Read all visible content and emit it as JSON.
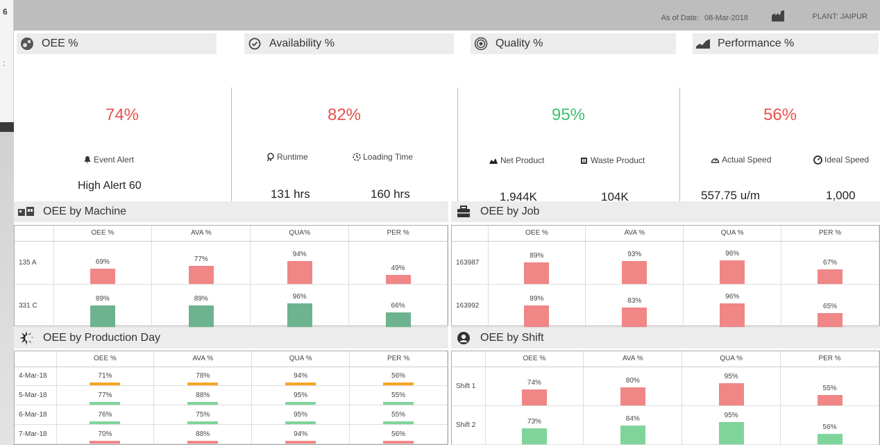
{
  "header": {
    "as_of_label": "As of Date:",
    "as_of_value": "08-Mar-2018",
    "plant": "PLANT: JAIPUR",
    "background_number": "6"
  },
  "kpis": {
    "oee": {
      "title": "OEE %",
      "value": "74%",
      "color": "#e8514a",
      "event_label": "Event Alert",
      "event_value": "High Alert 60"
    },
    "availability": {
      "title": "Availability %",
      "value": "82%",
      "color": "#e8514a",
      "runtime_label": "Runtime",
      "runtime_value": "131 hrs",
      "loading_label": "Loading Time",
      "loading_value": "160 hrs"
    },
    "quality": {
      "title": "Quality %",
      "value": "95%",
      "color": "#3fbf6e",
      "net_label": "Net Product",
      "net_value": "1,944K",
      "waste_label": "Waste Product",
      "waste_value": "104K"
    },
    "performance": {
      "title": "Performance %",
      "value": "56%",
      "color": "#e8514a",
      "actual_label": "Actual Speed",
      "actual_value": "557.75 u/m",
      "ideal_label": "Ideal Speed",
      "ideal_value": "1,000"
    }
  },
  "colors": {
    "red": "#f08686",
    "green": "#6db38f",
    "orange": "#f5a623",
    "light_green": "#7fd49a"
  },
  "machine": {
    "title": "OEE by Machine",
    "columns": [
      "OEE %",
      "AVA %",
      "QUA%",
      "PER %"
    ],
    "rows": [
      {
        "label": "135 A",
        "cells": [
          {
            "v": "69%",
            "n": 69,
            "c": "red"
          },
          {
            "v": "77%",
            "n": 77,
            "c": "red"
          },
          {
            "v": "94%",
            "n": 94,
            "c": "red"
          },
          {
            "v": "49%",
            "n": 49,
            "c": "red"
          }
        ]
      },
      {
        "label": "331 C",
        "cells": [
          {
            "v": "89%",
            "n": 89,
            "c": "green"
          },
          {
            "v": "89%",
            "n": 89,
            "c": "green"
          },
          {
            "v": "96%",
            "n": 96,
            "c": "green"
          },
          {
            "v": "66%",
            "n": 66,
            "c": "green"
          }
        ]
      }
    ]
  },
  "job": {
    "title": "OEE by Job",
    "columns": [
      "OEE %",
      "AVA %",
      "QUA %",
      "PER %"
    ],
    "rows": [
      {
        "label": "163987",
        "cells": [
          {
            "v": "89%",
            "n": 89,
            "c": "red"
          },
          {
            "v": "93%",
            "n": 93,
            "c": "red"
          },
          {
            "v": "96%",
            "n": 96,
            "c": "red"
          },
          {
            "v": "67%",
            "n": 67,
            "c": "red"
          }
        ]
      },
      {
        "label": "163992",
        "cells": [
          {
            "v": "89%",
            "n": 89,
            "c": "red"
          },
          {
            "v": "83%",
            "n": 83,
            "c": "red"
          },
          {
            "v": "96%",
            "n": 96,
            "c": "red"
          },
          {
            "v": "65%",
            "n": 65,
            "c": "red"
          }
        ]
      }
    ]
  },
  "day": {
    "title": "OEE by Production Day",
    "columns": [
      "OEE %",
      "AVA %",
      "QUA %",
      "PER %"
    ],
    "rows": [
      {
        "label": "4-Mar-18",
        "cells": [
          {
            "v": "71%",
            "c": "orange"
          },
          {
            "v": "78%",
            "c": "orange"
          },
          {
            "v": "94%",
            "c": "orange"
          },
          {
            "v": "56%",
            "c": "orange"
          }
        ]
      },
      {
        "label": "5-Mar-18",
        "cells": [
          {
            "v": "77%",
            "c": "light_green"
          },
          {
            "v": "88%",
            "c": "light_green"
          },
          {
            "v": "95%",
            "c": "light_green"
          },
          {
            "v": "55%",
            "c": "light_green"
          }
        ]
      },
      {
        "label": "6-Mar-18",
        "cells": [
          {
            "v": "76%",
            "c": "light_green"
          },
          {
            "v": "75%",
            "c": "light_green"
          },
          {
            "v": "95%",
            "c": "light_green"
          },
          {
            "v": "55%",
            "c": "light_green"
          }
        ]
      },
      {
        "label": "7-Mar-18",
        "cells": [
          {
            "v": "70%",
            "c": "red"
          },
          {
            "v": "88%",
            "c": "red"
          },
          {
            "v": "94%",
            "c": "red"
          },
          {
            "v": "56%",
            "c": "red"
          }
        ]
      }
    ]
  },
  "shift": {
    "title": "OEE by Shift",
    "columns": [
      "OEE %",
      "AVA %",
      "QUA %",
      "PER %"
    ],
    "rows": [
      {
        "label": "Shift 1",
        "cells": [
          {
            "v": "74%",
            "n": 74,
            "c": "red"
          },
          {
            "v": "80%",
            "n": 80,
            "c": "red"
          },
          {
            "v": "95%",
            "n": 95,
            "c": "red"
          },
          {
            "v": "55%",
            "n": 55,
            "c": "red"
          }
        ]
      },
      {
        "label": "Shift 2",
        "cells": [
          {
            "v": "73%",
            "n": 73,
            "c": "light_green"
          },
          {
            "v": "84%",
            "n": 84,
            "c": "light_green"
          },
          {
            "v": "95%",
            "n": 95,
            "c": "light_green"
          },
          {
            "v": "56%",
            "n": 56,
            "c": "light_green"
          }
        ]
      }
    ]
  }
}
